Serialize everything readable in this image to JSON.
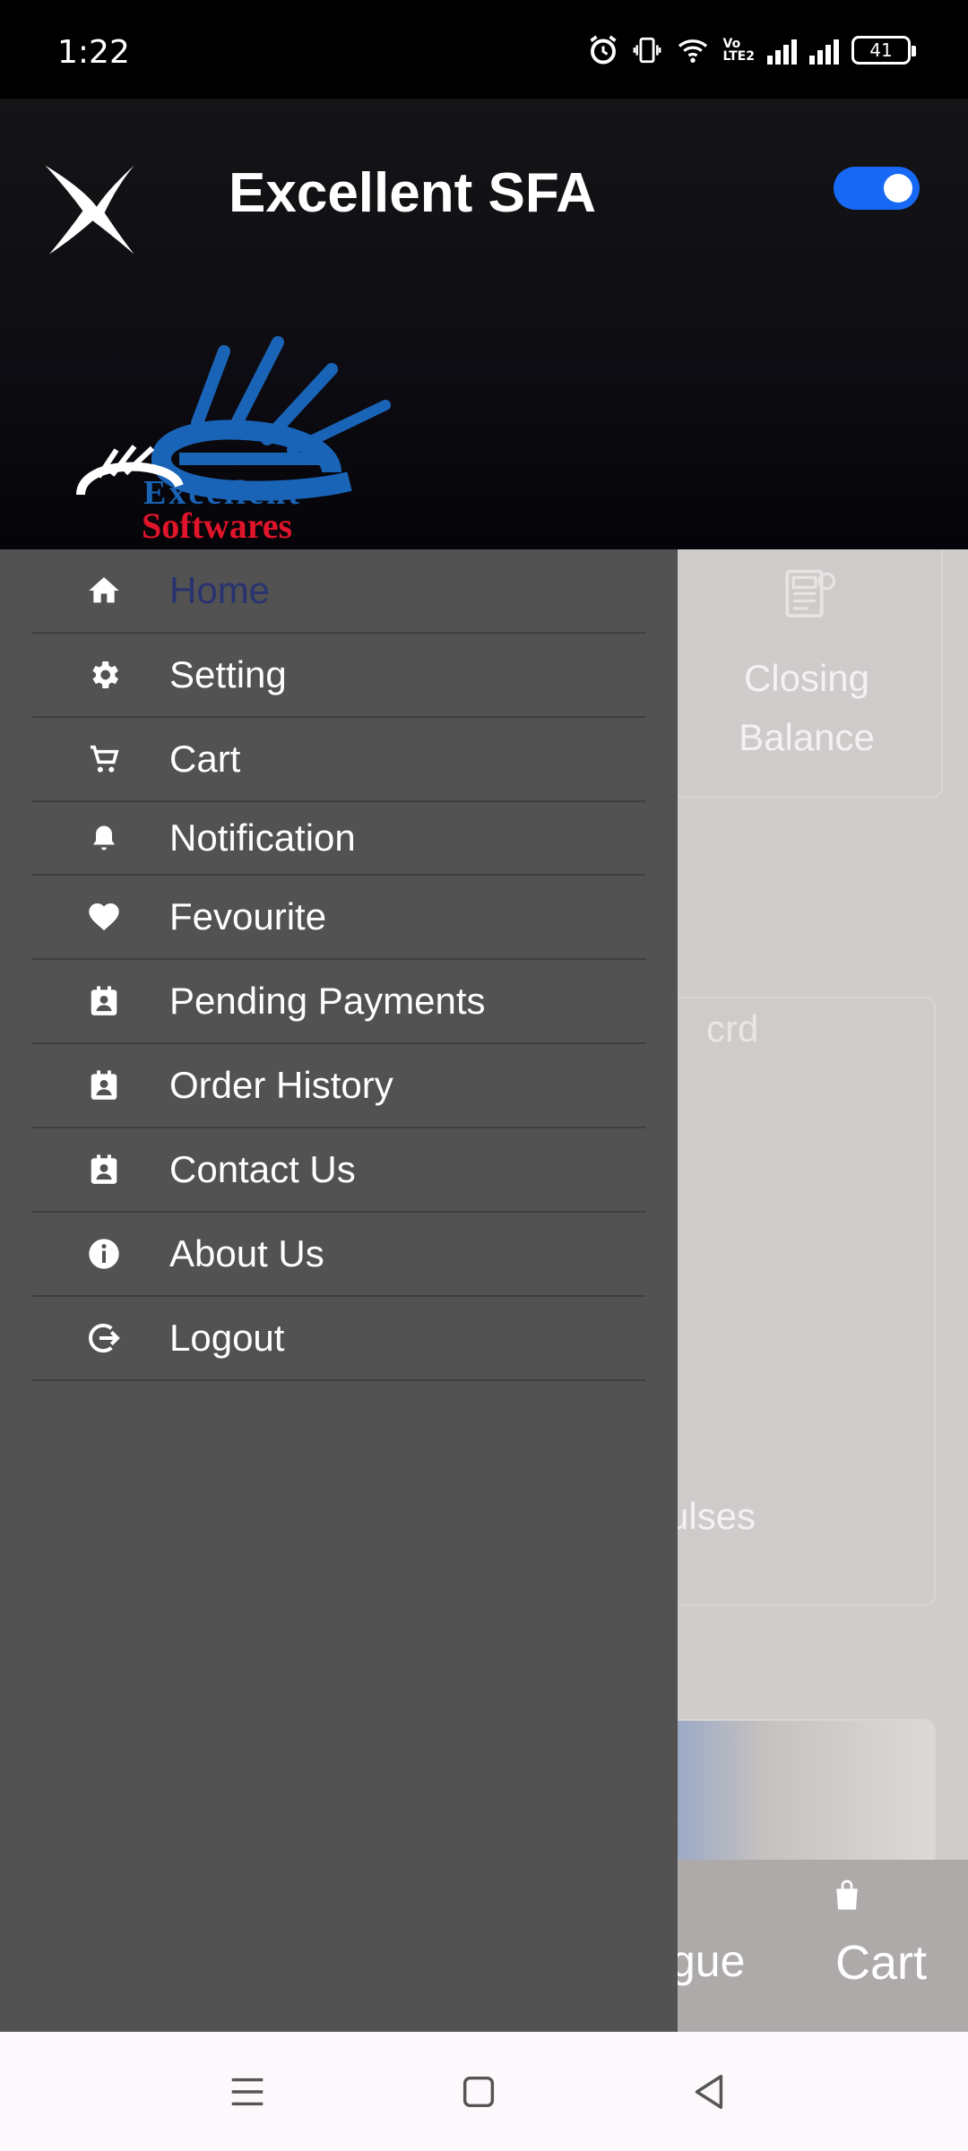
{
  "status_bar": {
    "time": "1:22",
    "battery": "41",
    "volte": [
      "Vo",
      "LTE2"
    ]
  },
  "header": {
    "title": "Excellent SFA",
    "toggle_on": true,
    "logo_text": [
      "Excellent",
      "Softwares"
    ]
  },
  "drawer": {
    "items": [
      {
        "label": "Home",
        "icon": "home-icon",
        "active": true
      },
      {
        "label": "Setting",
        "icon": "gear-icon"
      },
      {
        "label": "Cart",
        "icon": "cart-icon"
      },
      {
        "label": "Notification",
        "icon": "bell-icon"
      },
      {
        "label": "Fevourite",
        "icon": "heart-icon"
      },
      {
        "label": "Pending Payments",
        "icon": "contact-card-icon"
      },
      {
        "label": "Order History",
        "icon": "contact-card-icon"
      },
      {
        "label": "Contact Us",
        "icon": "contact-card-icon"
      },
      {
        "label": "About Us",
        "icon": "info-icon"
      },
      {
        "label": "Logout",
        "icon": "logout-icon"
      }
    ]
  },
  "background": {
    "closing_balance": [
      "Closing",
      "Balance"
    ],
    "card_text": "crd",
    "card_text_2": "ulses",
    "bottom_nav": [
      "gue",
      "Cart"
    ]
  },
  "colors": {
    "accent": "#1769f5",
    "drawer_bg": "#525252",
    "active_label": "#28336f"
  }
}
